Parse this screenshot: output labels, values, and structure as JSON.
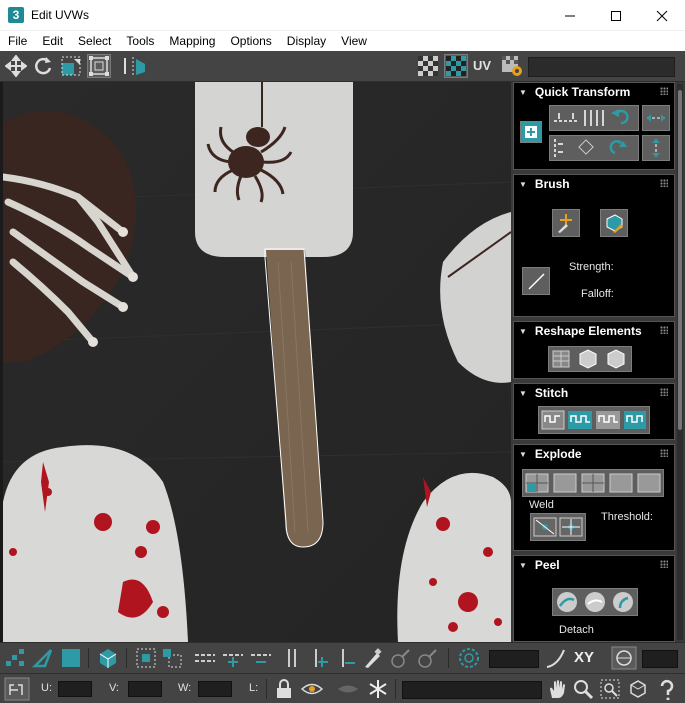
{
  "window": {
    "app_icon": "3",
    "title": "Edit UVWs"
  },
  "menu": [
    "File",
    "Edit",
    "Select",
    "Tools",
    "Mapping",
    "Options",
    "Display",
    "View"
  ],
  "toolbar_top": {
    "uv_label": "UV",
    "icons": [
      "move-icon",
      "rotate-icon",
      "scale-icon",
      "freeform-icon",
      "mirror-icon",
      "checker-icon",
      "checker-active-icon",
      "uv-settings-icon"
    ]
  },
  "panel": {
    "quick_transform": {
      "title": "Quick Transform"
    },
    "brush": {
      "title": "Brush",
      "strength_label": "Strength:",
      "falloff_label": "Falloff:"
    },
    "reshape": {
      "title": "Reshape Elements"
    },
    "stitch": {
      "title": "Stitch"
    },
    "explode": {
      "title": "Explode",
      "weld_label": "Weld",
      "threshold_label": "Threshold:"
    },
    "peel": {
      "title": "Peel",
      "detach_label": "Detach"
    }
  },
  "bottom": {
    "xy_label": "XY",
    "u_label": "U:",
    "v_label": "V:",
    "w_label": "W:",
    "l_label": "L:"
  },
  "colors": {
    "accent_teal": "#2e9aa6",
    "toolbar_bg": "#444444",
    "panel_bg": "#000000"
  }
}
